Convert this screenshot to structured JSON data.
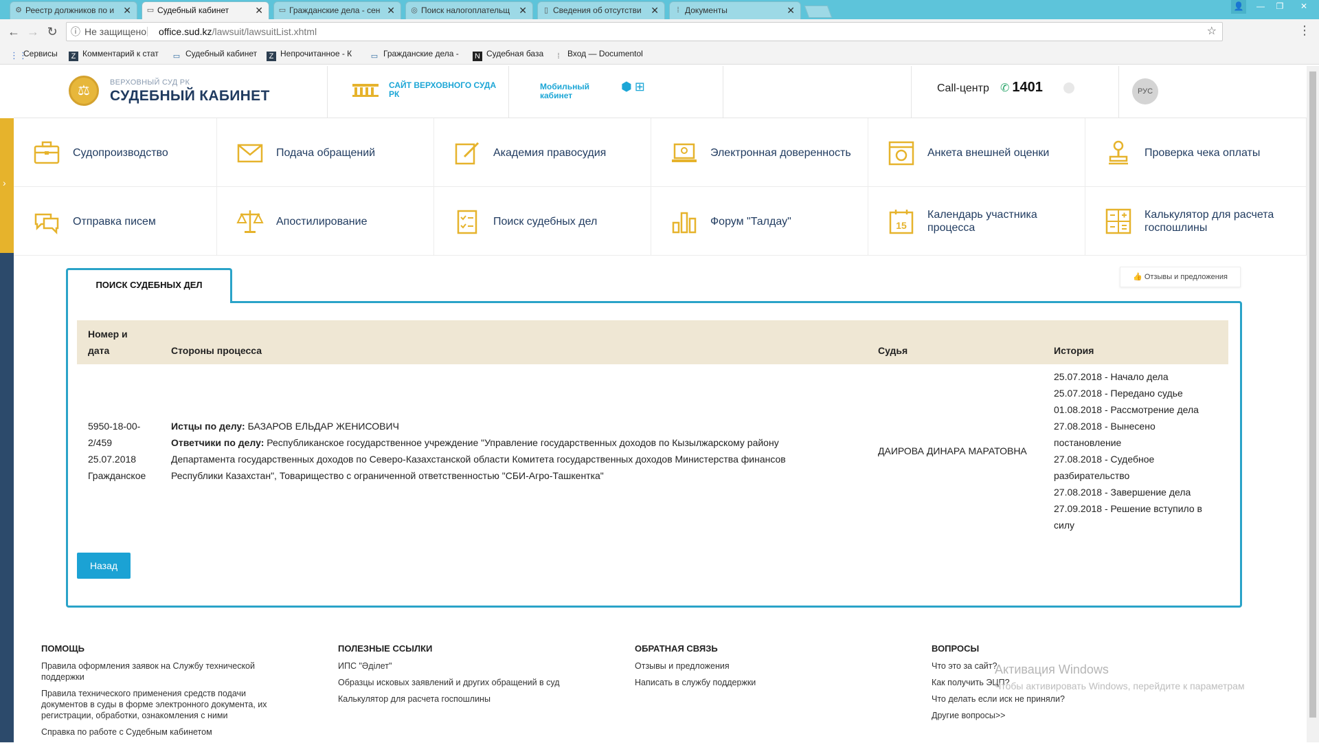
{
  "browser": {
    "tabs": [
      {
        "label": "Реестр должников по и",
        "icon": "registry-icon"
      },
      {
        "label": "Судебный кабинет",
        "icon": "court-icon",
        "active": true
      },
      {
        "label": "Гражданские дела - сен",
        "icon": "court-icon"
      },
      {
        "label": "Поиск налогоплательщ",
        "icon": "tax-icon"
      },
      {
        "label": "Сведения об отсутстви",
        "icon": "page-icon"
      },
      {
        "label": "Документы",
        "icon": "docs-icon"
      }
    ],
    "not_secure": "Не защищено",
    "url_host": "office.sud.kz",
    "url_path": "/lawsuit/lawsuitList.xhtml",
    "bookmarks": [
      {
        "label": "Сервисы",
        "icon": "apps-icon"
      },
      {
        "label": "Комментарий к стат",
        "icon": "z-icon"
      },
      {
        "label": "Судебный кабинет",
        "icon": "court-icon"
      },
      {
        "label": "Непрочитанное - К",
        "icon": "z-icon"
      },
      {
        "label": "Гражданские дела -",
        "icon": "court-icon"
      },
      {
        "label": "Судебная база",
        "icon": "n-icon"
      },
      {
        "label": "Вход — Documentol",
        "icon": "grid-icon"
      }
    ]
  },
  "header": {
    "logo_small": "ВЕРХОВНЫЙ СУД РК",
    "logo_big": "СУДЕБНЫЙ КАБИНЕТ",
    "supreme_site": "САЙТ ВЕРХОВНОГО СУДА РК",
    "mobile_cabinet": "Мобильный кабинет",
    "callcenter_label": "Call-центр",
    "callcenter_number": "1401",
    "lang": "РУС"
  },
  "services": [
    {
      "label": "Судопроизводство",
      "icon": "briefcase-icon"
    },
    {
      "label": "Подача обращений",
      "icon": "envelope-icon"
    },
    {
      "label": "Академия правосудия",
      "icon": "edit-icon"
    },
    {
      "label": "Электронная доверенность",
      "icon": "laptop-icon"
    },
    {
      "label": "Анкета внешней оценки",
      "icon": "survey-icon"
    },
    {
      "label": "Проверка чека оплаты",
      "icon": "stamp-icon"
    },
    {
      "label": "Отправка писем",
      "icon": "chat-icon"
    },
    {
      "label": "Апостилирование",
      "icon": "scales-icon"
    },
    {
      "label": "Поиск судебных дел",
      "icon": "checklist-icon"
    },
    {
      "label": "Форум \"Талдау\"",
      "icon": "bar-chart-icon"
    },
    {
      "label": "Календарь участника процесса",
      "icon": "calendar-icon"
    },
    {
      "label": "Калькулятор для расчета госпошлины",
      "icon": "calculator-icon"
    }
  ],
  "main": {
    "feedback": "Отзывы и предложения",
    "tab_title": "ПОИСК СУДЕБНЫХ ДЕЛ",
    "columns": {
      "number_date_1": "Номер и",
      "number_date_2": "дата",
      "parties": "Стороны процесса",
      "judge": "Судья",
      "history": "История"
    },
    "case": {
      "number_1": "5950-18-00-",
      "number_2": "2/459",
      "date": "25.07.2018",
      "type": "Гражданское",
      "plaintiff_label": "Истцы по делу:",
      "plaintiff": "БАЗАРОВ ЕЛЬДАР ЖЕНИСОВИЧ",
      "defendant_label": "Ответчики по делу:",
      "defendant_1": "Республиканское государственное учреждение \"Управление государственных доходов по Кызылжарскому району",
      "defendant_2": "Департамента государственных доходов по Северо-Казахстанской области Комитета государственных доходов Министерства финансов",
      "defendant_3": "Республики Казахстан\", Товарищество с ограниченной ответственностью \"СБИ-Агро-Ташкентка\"",
      "judge": "ДАИРОВА ДИНАРА МАРАТОВНА",
      "history": [
        "25.07.2018 - Начало дела",
        "25.07.2018 - Передано судье",
        "01.08.2018 - Рассмотрение дела",
        "27.08.2018 - Вынесено",
        "постановление",
        "27.08.2018 - Судебное",
        "разбирательство",
        "27.08.2018 - Завершение дела",
        "27.09.2018 - Решение вступило в",
        "силу"
      ]
    },
    "back": "Назад"
  },
  "footer": {
    "help": {
      "title": "ПОМОЩЬ",
      "links": [
        "Правила оформления заявок на Службу технической поддержки",
        "Правила технического применения средств подачи документов в суды в форме электронного документа, их регистрации, обработки, ознакомления с ними",
        "Справка по работе с Судебным кабинетом"
      ]
    },
    "useful": {
      "title": "ПОЛЕЗНЫЕ ССЫЛКИ",
      "links": [
        "ИПС \"Әділет\"",
        "Образцы исковых заявлений и других обращений в суд",
        "Калькулятор для расчета госпошлины"
      ]
    },
    "feedback": {
      "title": "ОБРАТНАЯ СВЯЗЬ",
      "links": [
        "Отзывы и предложения",
        "Написать в службу поддержки"
      ]
    },
    "questions": {
      "title": "ВОПРОСЫ",
      "links": [
        "Что это за сайт?",
        "Как получить ЭЦП?",
        "Что делать если иск не приняли?",
        "Другие вопросы>>"
      ]
    }
  },
  "watermark": {
    "line1": "Активация Windows",
    "line2": "Чтобы активировать Windows, перейдите к параметрам"
  },
  "colors": {
    "accent": "#1ba2d4",
    "card_border": "#2aa3c8",
    "table_header": "#efe7d4",
    "gold": "#e6b32c",
    "navy": "#1f3a5f"
  }
}
